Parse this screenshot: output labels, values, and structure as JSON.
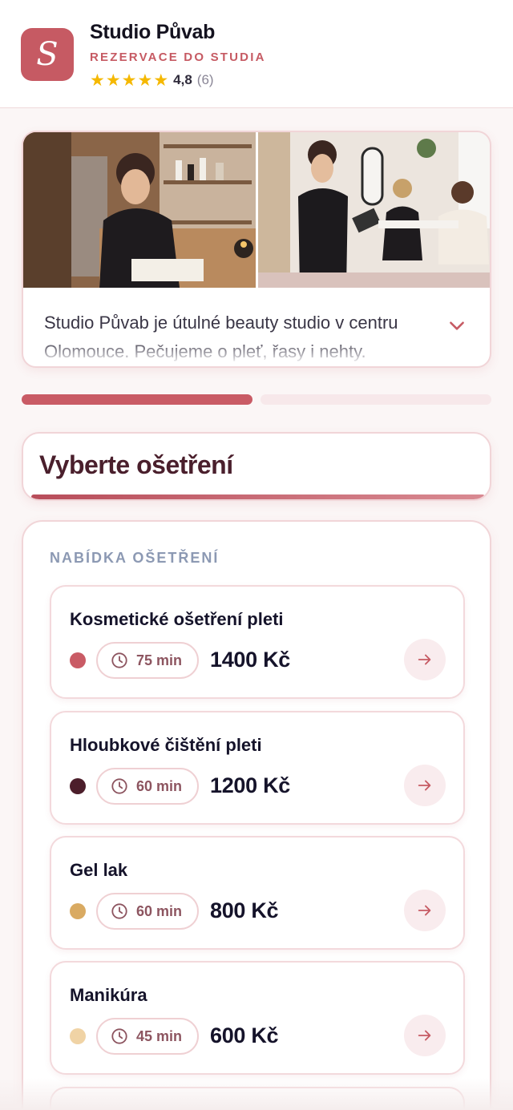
{
  "header": {
    "logo_letter": "S",
    "title": "Studio Půvab",
    "subtitle": "REZERVACE DO STUDIA",
    "rating_value": "4,8",
    "rating_count": "(6)",
    "star_count": 5,
    "star_color": "#f5b800",
    "brand_color": "#c65a63"
  },
  "gallery": {
    "description": "Studio Půvab je útulné beauty studio v centru Olomouce. Pečujeme o pleť, řasy i nehty.",
    "expand_icon": "chevron-down-icon"
  },
  "progress": {
    "current_step": 1,
    "total_steps": 2
  },
  "section": {
    "title": "Vyberte ošetření"
  },
  "services": {
    "label": "NABÍDKA OŠETŘENÍ",
    "items": [
      {
        "name": "Kosmetické ošetření pleti",
        "duration": "75 min",
        "price": "1400 Kč",
        "dot_color": "#c95b65"
      },
      {
        "name": "Hloubkové čištění pleti",
        "duration": "60 min",
        "price": "1200 Kč",
        "dot_color": "#4c1e2b"
      },
      {
        "name": "Gel lak",
        "duration": "60 min",
        "price": "800 Kč",
        "dot_color": "#d9aa62"
      },
      {
        "name": "Manikúra",
        "duration": "45 min",
        "price": "600 Kč",
        "dot_color": "#f0d3a5"
      }
    ]
  }
}
